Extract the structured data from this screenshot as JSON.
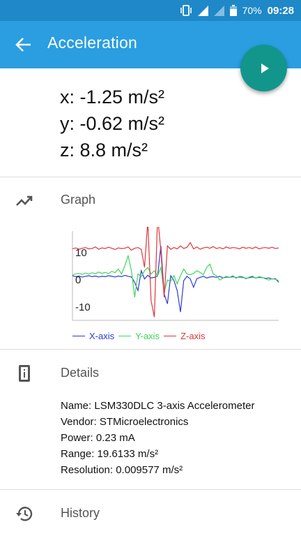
{
  "status_bar": {
    "battery": "70%",
    "time": "09:28",
    "icons": [
      "vibrate-icon",
      "signal-icon",
      "signal-empty-icon",
      "battery-icon"
    ]
  },
  "app_bar": {
    "title": "Acceleration",
    "back_icon": "arrow-left-icon",
    "fab_icon": "play-icon"
  },
  "readings": {
    "x": "x: -1.25 m/s²",
    "y": "y: -0.62 m/s²",
    "z": "z: 8.8 m/s²"
  },
  "graph_section": {
    "icon": "trending-up-icon",
    "label": "Graph"
  },
  "chart_data": {
    "type": "line",
    "ylim": [
      -13,
      14
    ],
    "y_ticks": [
      "10",
      "0",
      "-10"
    ],
    "grid": false,
    "legend_position": "bottom-left",
    "series": [
      {
        "name": "X-axis",
        "color": "#2b3bd6",
        "values": [
          0.5,
          0.2,
          0.4,
          0.1,
          0.3,
          0.5,
          0.2,
          0.4,
          0.1,
          0.3,
          0.2,
          0.5,
          0.3,
          0.1,
          0.4,
          0.2,
          0.6,
          0.3,
          0.1,
          -1.5,
          -4.0,
          2.0,
          -0.5,
          0.6,
          -0.2,
          0.0,
          0.4,
          9.5,
          -5.0,
          -8.0,
          0.5,
          -1.0,
          -4.0,
          -10.5,
          -1.0,
          0.3,
          -0.5,
          -3.0,
          -0.4,
          0.0,
          0.3,
          -0.2,
          0.1,
          0.2,
          0.0,
          0.3,
          -0.2,
          0.1,
          0.0,
          0.2,
          -0.1,
          0.1,
          0.0,
          -0.3,
          -0.1,
          0.1,
          -0.2,
          0.0,
          -0.1,
          -0.3,
          -0.2,
          -0.5,
          -0.4,
          -1.5
        ]
      },
      {
        "name": "Y-axis",
        "color": "#3fd65a",
        "values": [
          0.8,
          1.0,
          1.2,
          0.9,
          1.3,
          1.0,
          1.4,
          1.1,
          1.6,
          1.2,
          1.5,
          1.1,
          1.8,
          1.4,
          2.5,
          1.0,
          3.5,
          6.5,
          2.0,
          -6.0,
          1.0,
          0.2,
          2.0,
          3.0,
          1.0,
          2.0,
          0.5,
          3.0,
          -4.5,
          -0.8,
          -1.2,
          0.5,
          -2.0,
          0.5,
          2.5,
          1.0,
          0.8,
          1.2,
          2.0,
          1.5,
          0.8,
          3.0,
          4.0,
          1.0,
          0.5,
          -0.8,
          -0.2,
          0.3,
          0.0,
          0.5,
          -0.3,
          0.3,
          0.2,
          -0.5,
          0.1,
          0.4,
          -0.3,
          0.2,
          0.0,
          -0.5,
          -0.8,
          -0.4,
          -0.6,
          -1.0
        ]
      },
      {
        "name": "Z-axis",
        "color": "#e2343a",
        "values": [
          8.6,
          8.9,
          8.5,
          8.8,
          9.0,
          8.6,
          8.7,
          9.2,
          8.5,
          8.9,
          8.7,
          9.1,
          8.8,
          8.4,
          8.9,
          8.7,
          8.8,
          9.2,
          8.2,
          8.8,
          9.0,
          8.5,
          3.0,
          17.0,
          -7.0,
          -12.0,
          18.5,
          8.0,
          -6.0,
          9.5,
          8.5,
          9.0,
          8.6,
          9.5,
          8.7,
          9.1,
          10.5,
          8.6,
          9.2,
          8.5,
          8.9,
          9.1,
          8.8,
          9.3,
          8.7,
          9.0,
          8.6,
          9.2,
          8.8,
          9.0,
          8.9,
          8.6,
          9.1,
          8.8,
          9.0,
          8.7,
          9.2,
          8.6,
          8.9,
          9.0,
          8.8,
          9.1,
          8.7,
          8.9
        ]
      }
    ]
  },
  "details_section": {
    "icon": "device-info-icon",
    "label": "Details",
    "lines": [
      "Name: LSM330DLC 3-axis Accelerometer",
      "Vendor: STMicroelectronics",
      "Power: 0.23 mA",
      "Range: 19.6133 m/s²",
      "Resolution: 0.009577 m/s²"
    ]
  },
  "history_section": {
    "icon": "history-icon",
    "label": "History"
  }
}
